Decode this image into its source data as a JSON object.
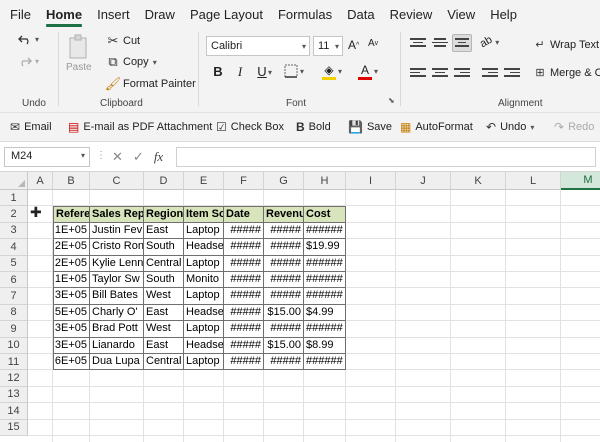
{
  "menu": [
    "File",
    "Home",
    "Insert",
    "Draw",
    "Page Layout",
    "Formulas",
    "Data",
    "Review",
    "View",
    "Help"
  ],
  "active_menu": "Home",
  "ribbon": {
    "undo_label": "Undo",
    "clipboard": {
      "paste": "Paste",
      "cut": "Cut",
      "copy": "Copy",
      "format_painter": "Format Painter",
      "label": "Clipboard"
    },
    "font": {
      "name": "Calibri",
      "size": "11",
      "label": "Font",
      "bold": "B",
      "italic": "I",
      "underline": "U"
    },
    "alignment": {
      "wrap_text": "Wrap Text",
      "merge": "Merge & C",
      "label": "Alignment"
    }
  },
  "quick_toolbar": {
    "email": "Email",
    "email_pdf": "E-mail as PDF Attachment",
    "check_box": "Check Box",
    "bold": "Bold",
    "save": "Save",
    "autoformat": "AutoFormat",
    "undo": "Undo",
    "redo": "Redo"
  },
  "formula_bar": {
    "name_box": "M24",
    "fx": "fx",
    "value": ""
  },
  "columns": [
    "A",
    "B",
    "C",
    "D",
    "E",
    "F",
    "G",
    "H",
    "I",
    "J",
    "K",
    "L",
    "M"
  ],
  "selected_column": "M",
  "rows": [
    "1",
    "2",
    "3",
    "4",
    "5",
    "6",
    "7",
    "8",
    "9",
    "10",
    "11",
    "12",
    "13",
    "14",
    "15"
  ],
  "table": {
    "headers": [
      "Refere",
      "Sales Rep",
      "Region",
      "Item So",
      "Date",
      "Revenu",
      "Cost"
    ],
    "rows": [
      [
        "1E+05",
        "Justin Fev",
        "East",
        "Laptop",
        "#####",
        "#####",
        "######"
      ],
      [
        "2E+05",
        "Cristo Ron",
        "South",
        "Headse",
        "#####",
        "#####",
        "$19.99"
      ],
      [
        "2E+05",
        "Kylie Lenn",
        "Central",
        "Laptop",
        "#####",
        "#####",
        "######"
      ],
      [
        "1E+05",
        "Taylor Sw",
        "South",
        "Monito",
        "#####",
        "#####",
        "######"
      ],
      [
        "3E+05",
        "Bill Bates",
        "West",
        "Laptop",
        "#####",
        "#####",
        "######"
      ],
      [
        "5E+05",
        "Charly O'",
        "East",
        "Headse",
        "#####",
        "$15.00",
        "$4.99"
      ],
      [
        "3E+05",
        "Brad Pott",
        "West",
        "Laptop",
        "#####",
        "#####",
        "######"
      ],
      [
        "3E+05",
        "Lianardo",
        "East",
        "Headse",
        "#####",
        "$15.00",
        "$8.99"
      ],
      [
        "6E+05",
        "Dua Lupa",
        "Central",
        "Laptop",
        "#####",
        "#####",
        "######"
      ]
    ]
  },
  "colors": {
    "accent": "#1e7145",
    "header_fill": "#d8e4bc"
  }
}
